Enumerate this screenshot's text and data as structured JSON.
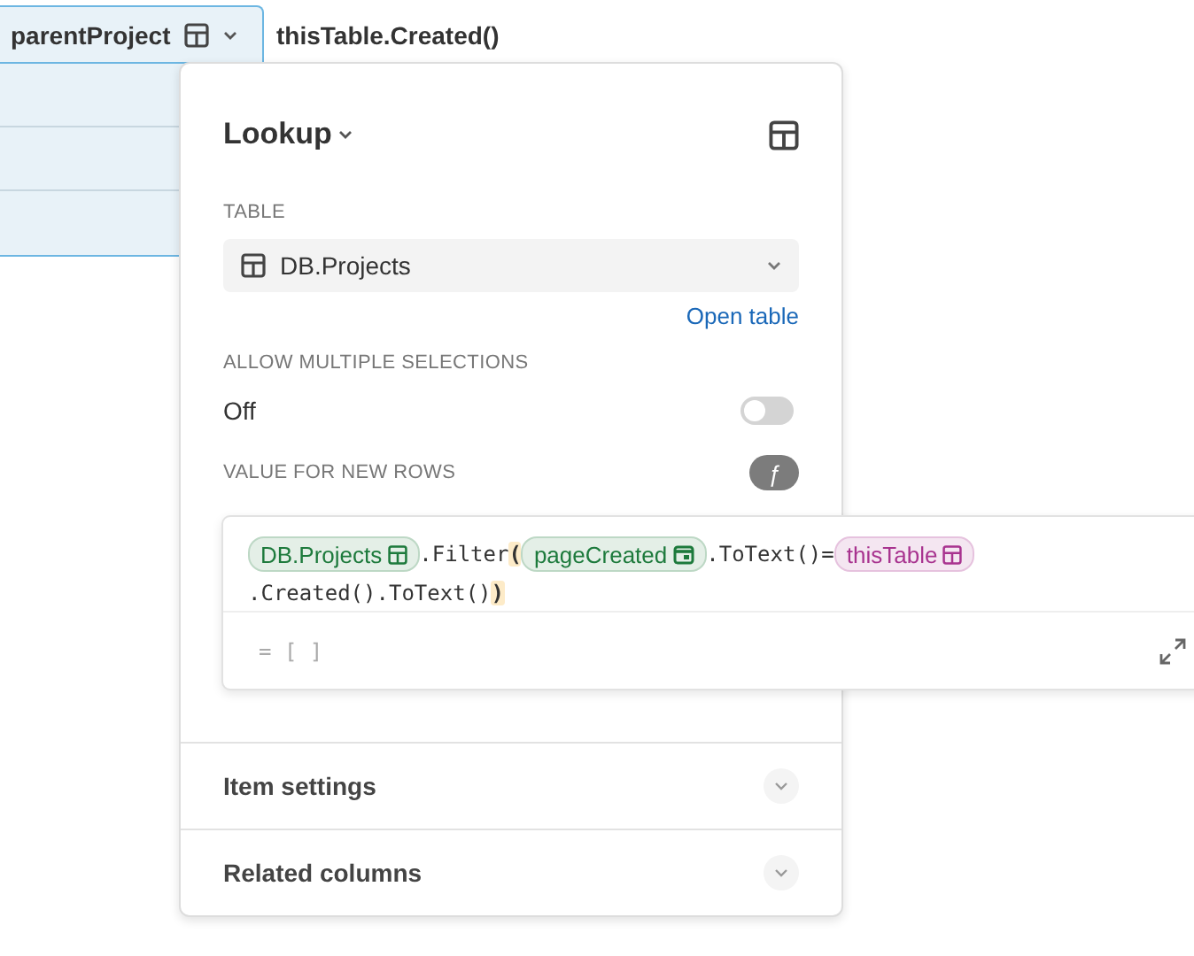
{
  "column_header": {
    "title": "parentProject",
    "selected": true
  },
  "next_column": {
    "title": "thisTable.Created()"
  },
  "popover": {
    "title": "Lookup",
    "table": {
      "label": "TABLE",
      "value": "DB.Projects",
      "link": "Open table"
    },
    "multiple": {
      "label": "ALLOW MULTIPLE SELECTIONS",
      "value": "Off",
      "on": false
    },
    "default_value": {
      "label": "VALUE FOR NEW ROWS",
      "formula_button": "ƒ"
    },
    "accordions": [
      {
        "title": "Item settings",
        "expanded": false
      },
      {
        "title": "Related columns",
        "expanded": false
      }
    ]
  },
  "formula": {
    "lines": [
      [
        {
          "kind": "table_ref",
          "text": "DB.Projects",
          "color": "#1d7a3c"
        },
        {
          "kind": "code",
          "text": ".Filter"
        },
        {
          "kind": "paren",
          "text": "("
        },
        {
          "kind": "date_ref",
          "text": "pageCreated",
          "color": "#1d7a3c"
        },
        {
          "kind": "code",
          "text": ".ToText()="
        },
        {
          "kind": "table_ref",
          "text": "thisTable",
          "color": "#a8338f"
        }
      ],
      [
        {
          "kind": "code",
          "text": ".Created().ToText()"
        },
        {
          "kind": "paren",
          "text": ")"
        }
      ]
    ],
    "result": "= [ ]"
  }
}
